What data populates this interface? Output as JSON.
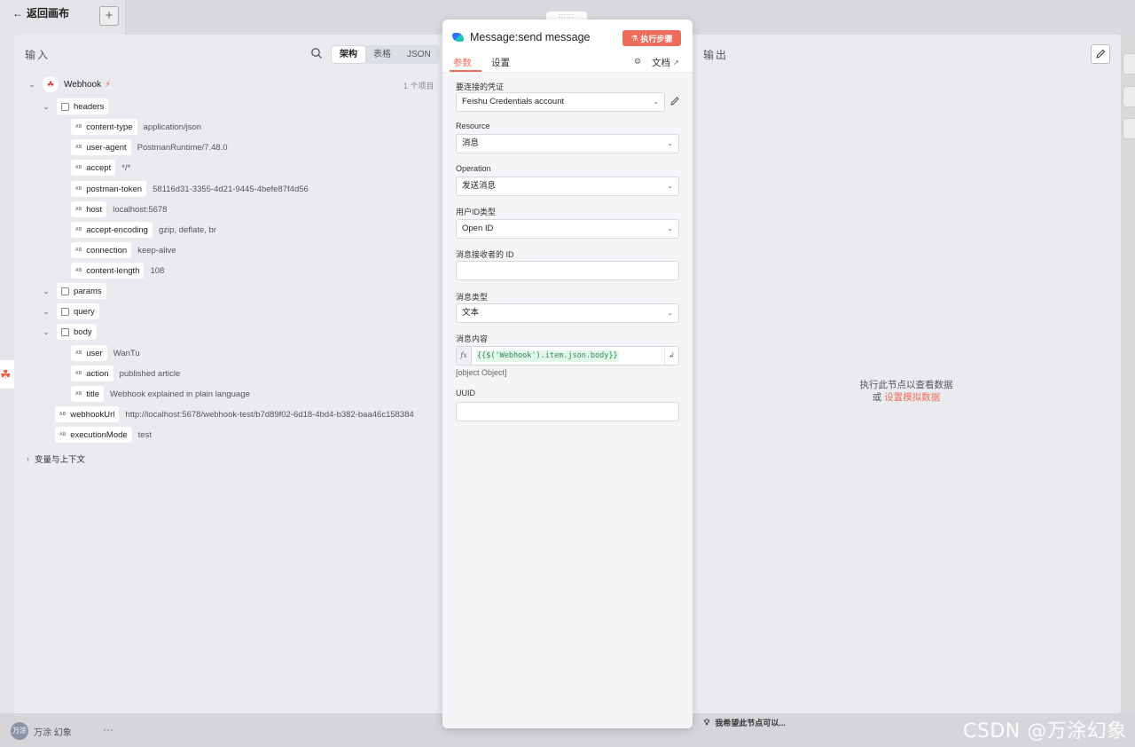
{
  "back": {
    "label": "返回画布"
  },
  "user": {
    "avatar": "万涂",
    "name": "万涂 幻象"
  },
  "hint": "我希望此节点可以...",
  "watermark": "CSDN @万涂幻象",
  "input": {
    "title": "输入",
    "modes": [
      "架构",
      "表格",
      "JSON"
    ],
    "active_mode": "架构",
    "node_name": "Webhook",
    "item_count": "1 个项目",
    "vars_context": "变量与上下文",
    "rows": [
      {
        "key": "headers",
        "type": "object",
        "level": 1
      },
      {
        "key": "content-type",
        "value": "application/json",
        "type": "string",
        "level": 2
      },
      {
        "key": "user-agent",
        "value": "PostmanRuntime/7.48.0",
        "type": "string",
        "level": 2
      },
      {
        "key": "accept",
        "value": "*/*",
        "type": "string",
        "level": 2
      },
      {
        "key": "postman-token",
        "value": "58116d31-3355-4d21-9445-4befe87f4d56",
        "type": "string",
        "level": 2
      },
      {
        "key": "host",
        "value": "localhost:5678",
        "type": "string",
        "level": 2
      },
      {
        "key": "accept-encoding",
        "value": "gzip, deflate, br",
        "type": "string",
        "level": 2
      },
      {
        "key": "connection",
        "value": "keep-alive",
        "type": "string",
        "level": 2
      },
      {
        "key": "content-length",
        "value": "108",
        "type": "string",
        "level": 2
      },
      {
        "key": "params",
        "type": "object",
        "level": 1
      },
      {
        "key": "query",
        "type": "object",
        "level": 1
      },
      {
        "key": "body",
        "type": "object",
        "level": 1
      },
      {
        "key": "user",
        "value": "WanTu",
        "type": "string",
        "level": 2
      },
      {
        "key": "action",
        "value": "published article",
        "type": "string",
        "level": 2
      },
      {
        "key": "title",
        "value": "Webhook explained in plain language",
        "type": "string",
        "level": 2
      },
      {
        "key": "webhookUrl",
        "value": "http://localhost:5678/webhook-test/b7d89f02-6d18-4bd4-b382-baa46c158384",
        "type": "string",
        "level": 1
      },
      {
        "key": "executionMode",
        "value": "test",
        "type": "string",
        "level": 1
      }
    ]
  },
  "node": {
    "title": "Message:send message",
    "exec_label": "执行步骤",
    "tabs": [
      "参数",
      "设置"
    ],
    "doc_label": "文档",
    "fields": {
      "credential": {
        "label": "要连接的凭证",
        "value": "Feishu Credentials account"
      },
      "resource": {
        "label": "Resource",
        "value": "消息"
      },
      "operation": {
        "label": "Operation",
        "value": "发送消息"
      },
      "id_type": {
        "label": "用户ID类型",
        "value": "Open ID"
      },
      "receiver_id": {
        "label": "消息接收者的 ID",
        "value": ""
      },
      "msg_type": {
        "label": "消息类型",
        "value": "文本"
      },
      "content": {
        "label": "消息内容",
        "expr": "{{$('Webhook').item.json.body}}",
        "result": "[object Object]"
      },
      "uuid": {
        "label": "UUID",
        "value": ""
      }
    }
  },
  "output": {
    "title": "输出",
    "empty_line1": "执行此节点以查看数据",
    "empty_or": "或",
    "empty_link": "设置模拟数据"
  },
  "colors": {
    "accent": "#ee6c5b",
    "expr_green": "#2e8b57"
  }
}
